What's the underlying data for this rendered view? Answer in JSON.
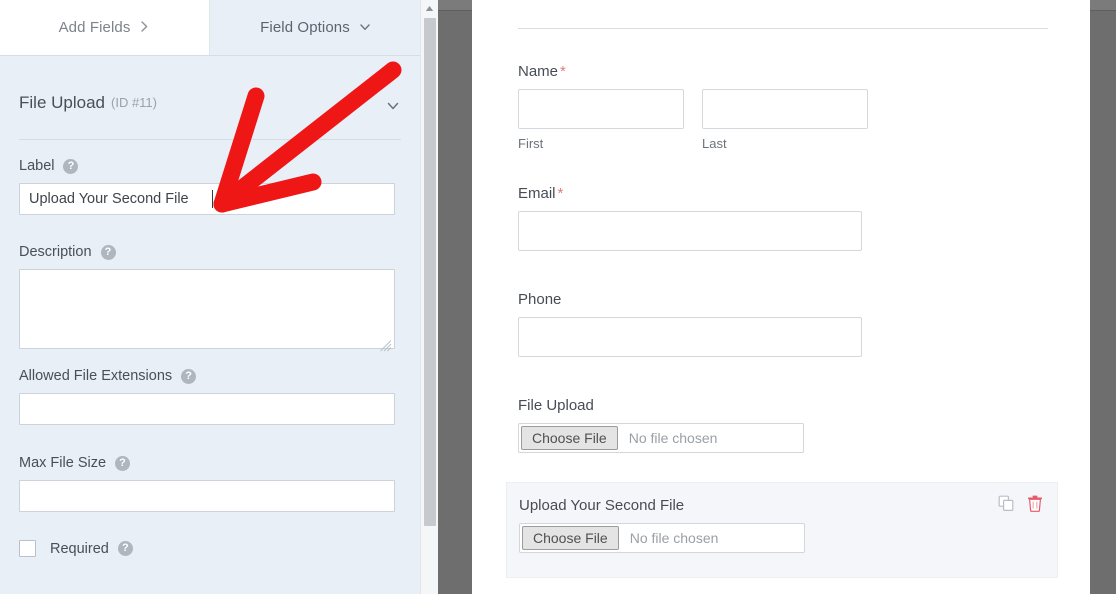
{
  "builder": {
    "tabs": [
      {
        "label": "Add Fields",
        "icon": "chevron-right-icon",
        "active": false
      },
      {
        "label": "Field Options",
        "icon": "chevron-down-icon",
        "active": true
      }
    ],
    "field_header": {
      "title": "File Upload",
      "id_text": "(ID #11)",
      "collapse_icon": "chevron-down-icon"
    },
    "options": [
      {
        "label": "Label",
        "help_icon": "question-mark-icon",
        "help_glyph": "?",
        "type": "text",
        "value": "Upload Your Second File",
        "placeholder": "",
        "focused": true
      },
      {
        "label": "Description",
        "help_icon": "question-mark-icon",
        "help_glyph": "?",
        "type": "textarea",
        "value": "",
        "placeholder": ""
      },
      {
        "label": "Allowed File Extensions",
        "help_icon": "question-mark-icon",
        "help_glyph": "?",
        "type": "text",
        "value": "",
        "placeholder": ""
      },
      {
        "label": "Max File Size",
        "help_icon": "question-mark-icon",
        "help_glyph": "?",
        "type": "text",
        "value": "",
        "placeholder": ""
      }
    ],
    "required": {
      "label": "Required",
      "checked": false,
      "help_icon": "question-mark-icon",
      "help_glyph": "?"
    },
    "scrollbar": {
      "up_arrow_icon": "caret-up-icon"
    }
  },
  "preview": {
    "fields": {
      "name": {
        "label": "Name",
        "required_marker": "*",
        "subfields": [
          {
            "label": "First",
            "value": "",
            "placeholder": ""
          },
          {
            "label": "Last",
            "value": "",
            "placeholder": ""
          }
        ]
      },
      "email": {
        "label": "Email",
        "required_marker": "*",
        "value": "",
        "placeholder": ""
      },
      "phone": {
        "label": "Phone",
        "required_marker": "",
        "value": "",
        "placeholder": ""
      },
      "file_upload": {
        "label": "File Upload",
        "button_label": "Choose File",
        "status_text": "No file chosen"
      },
      "file_upload_second": {
        "label": "Upload Your Second File",
        "button_label": "Choose File",
        "status_text": "No file chosen",
        "tools": [
          {
            "name": "duplicate-icon",
            "color": "#b9bec6"
          },
          {
            "name": "trash-icon",
            "color": "#e8596b"
          }
        ]
      }
    }
  },
  "annotation": {
    "type": "arrow",
    "color": "#ef1616",
    "points_to": "label-input"
  },
  "colors": {
    "panel_bg": "#e9eff7",
    "tab_active_bg": "#e9eff7",
    "tab_inactive_bg": "#ffffff",
    "gutter": "#6e6e6e",
    "annotation_red": "#ef1616",
    "required_asterisk": "#e27c7c",
    "trash_red": "#e8596b"
  }
}
